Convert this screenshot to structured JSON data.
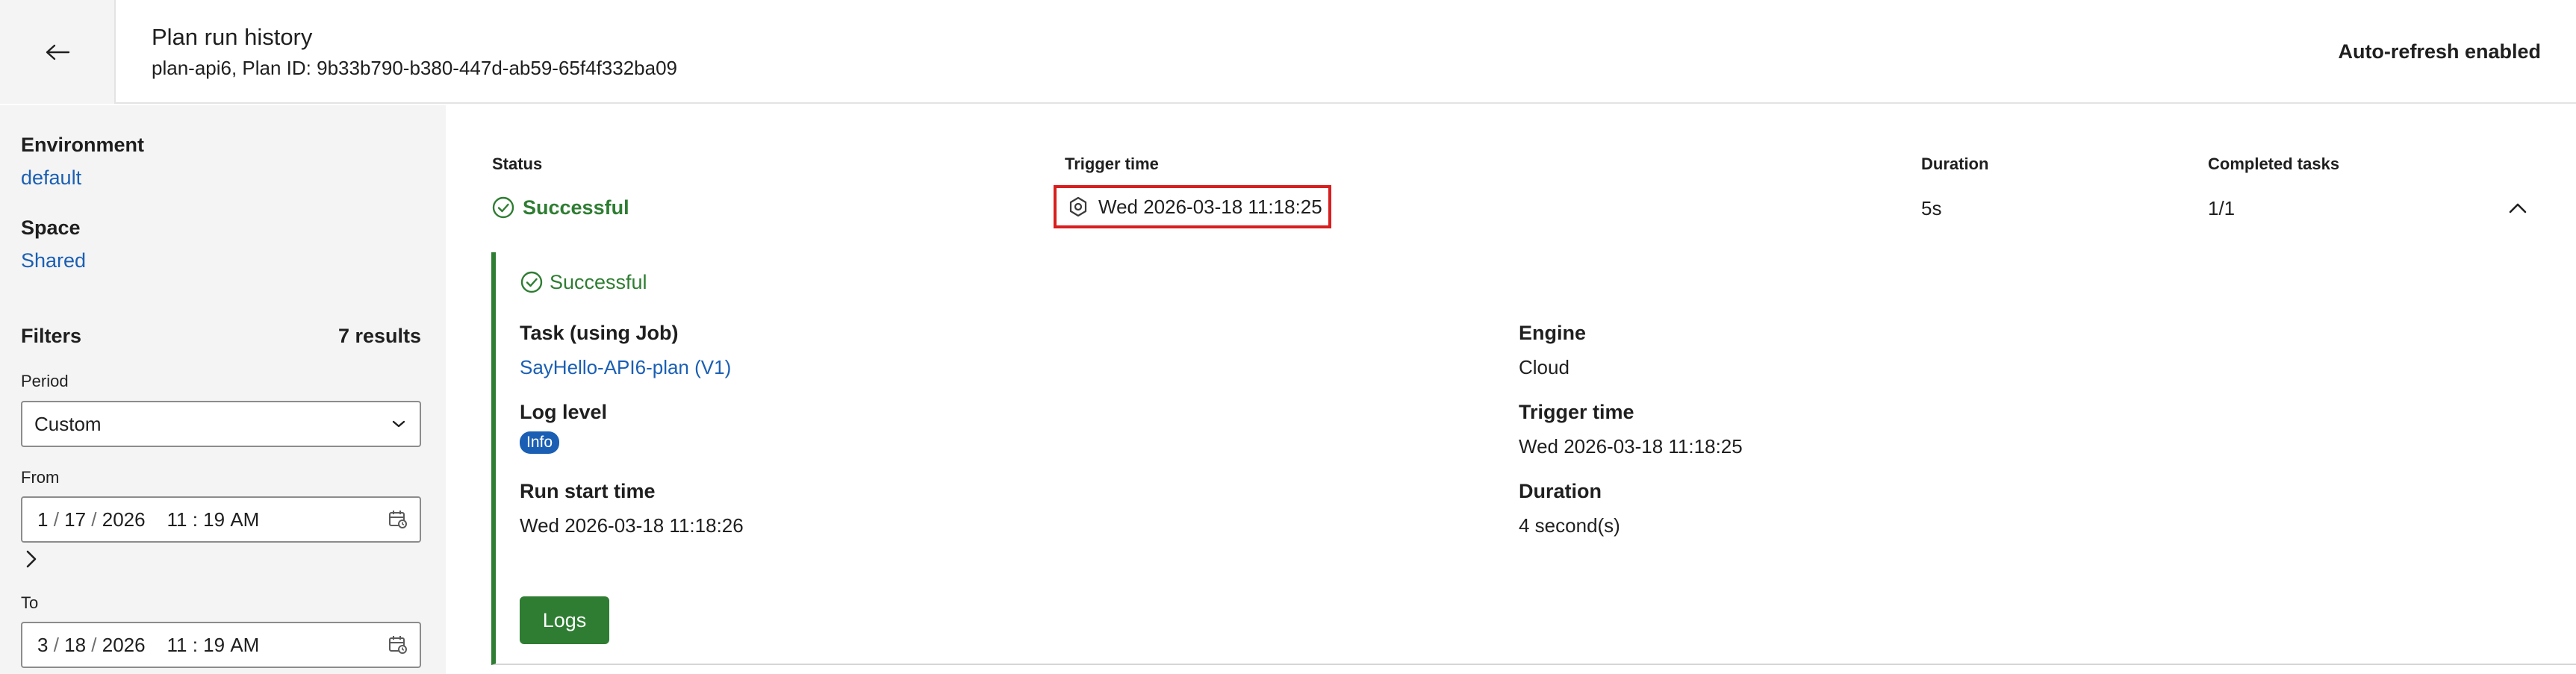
{
  "header": {
    "title": "Plan run history",
    "subtitle": "plan-api6, Plan ID: 9b33b790-b380-447d-ab59-65f4f332ba09",
    "auto_refresh": "Auto-refresh enabled",
    "back_icon": "arrow-left-icon"
  },
  "sidebar": {
    "environment_label": "Environment",
    "environment_value": "default",
    "space_label": "Space",
    "space_value": "Shared",
    "filters_label": "Filters",
    "results_count": "7 results",
    "period_label": "Period",
    "period_value": "Custom",
    "from_label": "From",
    "from_month": "1",
    "from_day": "17",
    "from_year": "2026",
    "from_hour": "11",
    "from_minute": "19",
    "from_ampm": "AM",
    "to_label": "To",
    "to_month": "3",
    "to_day": "18",
    "to_year": "2026",
    "to_hour": "11",
    "to_minute": "19",
    "to_ampm": "AM"
  },
  "table": {
    "headers": {
      "status": "Status",
      "trigger_time": "Trigger time",
      "duration": "Duration",
      "completed_tasks": "Completed tasks"
    },
    "row": {
      "status": "Successful",
      "trigger_time": "Wed 2026-03-18 11:18:25",
      "duration": "5s",
      "completed_tasks": "1/1"
    }
  },
  "detail": {
    "status": "Successful",
    "task_label": "Task (using Job)",
    "task_value": "SayHello-API6-plan (V1)",
    "engine_label": "Engine",
    "engine_value": "Cloud",
    "log_level_label": "Log level",
    "log_level_value": "Info",
    "trigger_time_label": "Trigger time",
    "trigger_time_value": "Wed 2026-03-18 11:18:25",
    "run_start_label": "Run start time",
    "run_start_value": "Wed 2026-03-18 11:18:26",
    "duration_label": "Duration",
    "duration_value": "4 second(s)",
    "logs_button": "Logs"
  },
  "colors": {
    "success": "#2e7d32",
    "link": "#1a5fb4",
    "highlight": "#d81e1e"
  }
}
